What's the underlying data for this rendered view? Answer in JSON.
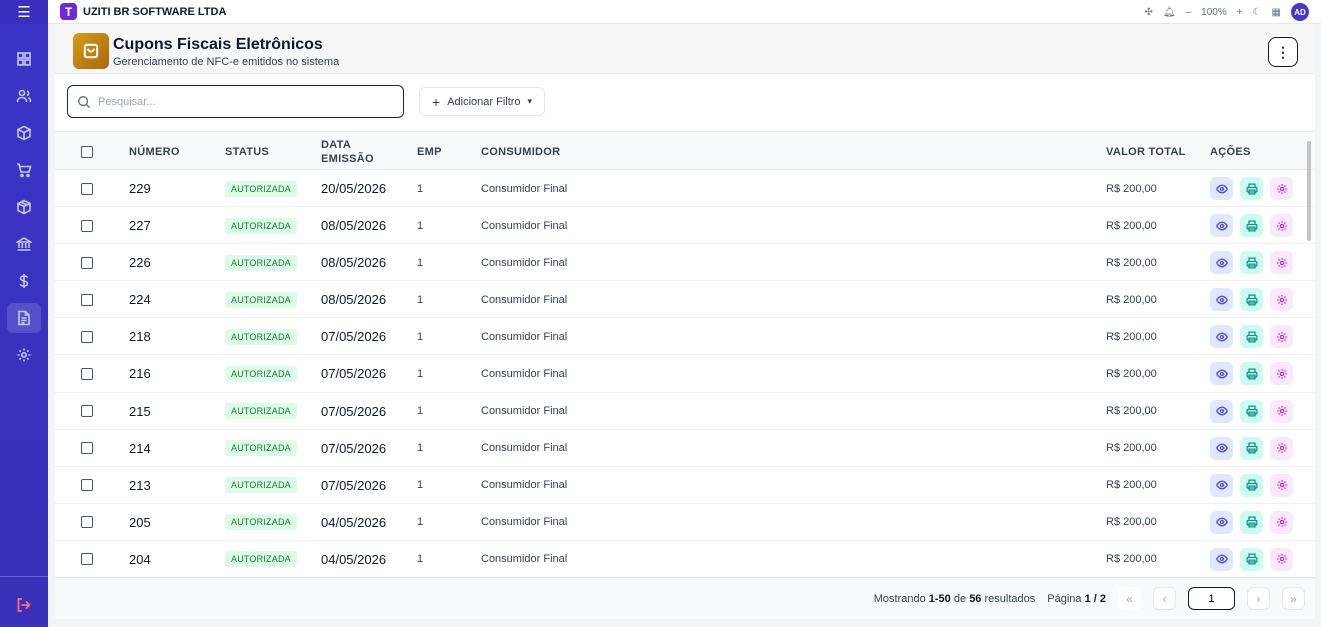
{
  "app": {
    "company": "UZITI BR SOFTWARE LTDA",
    "logo_letter": "T",
    "zoom": "100%",
    "avatar": "AD"
  },
  "header": {
    "title": "Cupons Fiscais Eletrônicos",
    "subtitle": "Gerenciamento de NFC-e emitidos no sistema"
  },
  "search": {
    "placeholder": "Pesquisar..."
  },
  "filter": {
    "label": "Adicionar Filtro"
  },
  "table": {
    "columns": {
      "numero": "NÚMERO",
      "status": "STATUS",
      "data1": "DATA",
      "data2": "EMISSÃO",
      "emp": "EMP",
      "consumidor": "CONSUMIDOR",
      "valor": "VALOR TOTAL",
      "acoes": "AÇÕES"
    },
    "rows": [
      {
        "numero": "229",
        "status": "AUTORIZADA",
        "data": "20/05/2026",
        "emp": "1",
        "consumidor": "Consumidor Final",
        "valor": "R$ 200,00"
      },
      {
        "numero": "227",
        "status": "AUTORIZADA",
        "data": "08/05/2026",
        "emp": "1",
        "consumidor": "Consumidor Final",
        "valor": "R$ 200,00"
      },
      {
        "numero": "226",
        "status": "AUTORIZADA",
        "data": "08/05/2026",
        "emp": "1",
        "consumidor": "Consumidor Final",
        "valor": "R$ 200,00"
      },
      {
        "numero": "224",
        "status": "AUTORIZADA",
        "data": "08/05/2026",
        "emp": "1",
        "consumidor": "Consumidor Final",
        "valor": "R$ 200,00"
      },
      {
        "numero": "218",
        "status": "AUTORIZADA",
        "data": "07/05/2026",
        "emp": "1",
        "consumidor": "Consumidor Final",
        "valor": "R$ 200,00"
      },
      {
        "numero": "216",
        "status": "AUTORIZADA",
        "data": "07/05/2026",
        "emp": "1",
        "consumidor": "Consumidor Final",
        "valor": "R$ 200,00"
      },
      {
        "numero": "215",
        "status": "AUTORIZADA",
        "data": "07/05/2026",
        "emp": "1",
        "consumidor": "Consumidor Final",
        "valor": "R$ 200,00"
      },
      {
        "numero": "214",
        "status": "AUTORIZADA",
        "data": "07/05/2026",
        "emp": "1",
        "consumidor": "Consumidor Final",
        "valor": "R$ 200,00"
      },
      {
        "numero": "213",
        "status": "AUTORIZADA",
        "data": "07/05/2026",
        "emp": "1",
        "consumidor": "Consumidor Final",
        "valor": "R$ 200,00"
      },
      {
        "numero": "205",
        "status": "AUTORIZADA",
        "data": "04/05/2026",
        "emp": "1",
        "consumidor": "Consumidor Final",
        "valor": "R$ 200,00"
      },
      {
        "numero": "204",
        "status": "AUTORIZADA",
        "data": "04/05/2026",
        "emp": "1",
        "consumidor": "Consumidor Final",
        "valor": "R$ 200,00"
      }
    ]
  },
  "pagination": {
    "showing_prefix": "Mostrando",
    "range": "1-50",
    "of": "de",
    "total": "56",
    "suffix": "resultados",
    "page_label": "Página",
    "page_value": "1 / 2",
    "current_page": "1"
  }
}
